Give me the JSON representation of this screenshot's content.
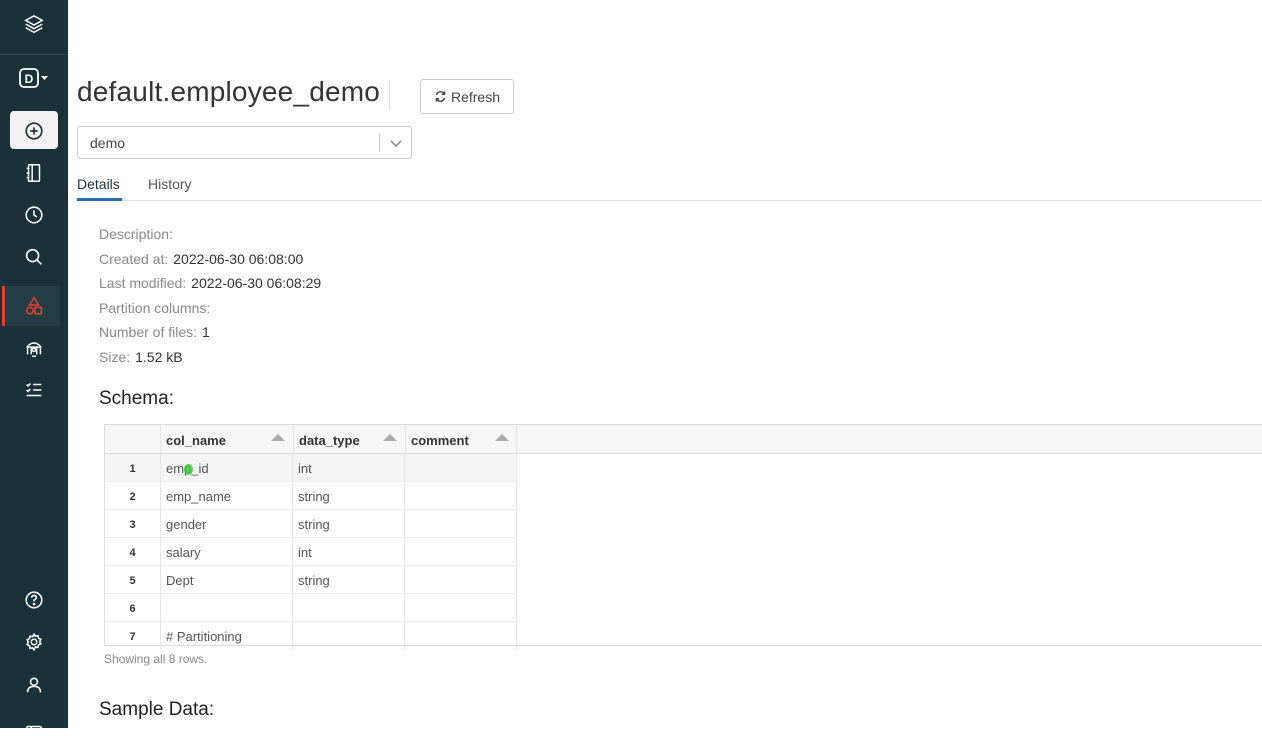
{
  "page": {
    "title": "default.employee_demo",
    "refresh_label": "Refresh",
    "cluster_select": {
      "value": "demo"
    },
    "tabs": [
      {
        "label": "Details",
        "active": true
      },
      {
        "label": "History",
        "active": false
      }
    ]
  },
  "details": {
    "description": {
      "label": "Description:",
      "value": ""
    },
    "created_at": {
      "label": "Created at:",
      "value": "2022-06-30 06:08:00"
    },
    "last_modified": {
      "label": "Last modified:",
      "value": "2022-06-30 06:08:29"
    },
    "partition_columns": {
      "label": "Partition columns:",
      "value": ""
    },
    "number_of_files": {
      "label": "Number of files:",
      "value": "1"
    },
    "size": {
      "label": "Size:",
      "value": "1.52 kB"
    }
  },
  "schema": {
    "heading": "Schema:",
    "columns": [
      "col_name",
      "data_type",
      "comment"
    ],
    "rows": [
      {
        "num": "1",
        "col_name": "emp_id",
        "data_type": "int",
        "comment": ""
      },
      {
        "num": "2",
        "col_name": "emp_name",
        "data_type": "string",
        "comment": ""
      },
      {
        "num": "3",
        "col_name": "gender",
        "data_type": "string",
        "comment": ""
      },
      {
        "num": "4",
        "col_name": "salary",
        "data_type": "int",
        "comment": ""
      },
      {
        "num": "5",
        "col_name": "Dept",
        "data_type": "string",
        "comment": ""
      },
      {
        "num": "6",
        "col_name": "",
        "data_type": "",
        "comment": ""
      },
      {
        "num": "7",
        "col_name": "# Partitioning",
        "data_type": "",
        "comment": ""
      }
    ],
    "footer": "Showing all 8 rows."
  },
  "sample_data": {
    "heading": "Sample Data:"
  },
  "sidebar": {
    "items": [
      {
        "name": "databricks-logo-icon"
      },
      {
        "name": "persona-switcher-icon",
        "label": "D"
      },
      {
        "name": "create-icon"
      },
      {
        "name": "workspace-icon"
      },
      {
        "name": "recents-icon"
      },
      {
        "name": "search-icon"
      },
      {
        "name": "data-icon"
      },
      {
        "name": "compute-icon"
      },
      {
        "name": "jobs-icon"
      },
      {
        "name": "help-icon"
      },
      {
        "name": "settings-icon"
      },
      {
        "name": "account-icon"
      }
    ]
  },
  "colors": {
    "sidebar_bg": "#1b3139",
    "accent_red": "#e0402f",
    "tab_underline": "#2c6db2"
  }
}
